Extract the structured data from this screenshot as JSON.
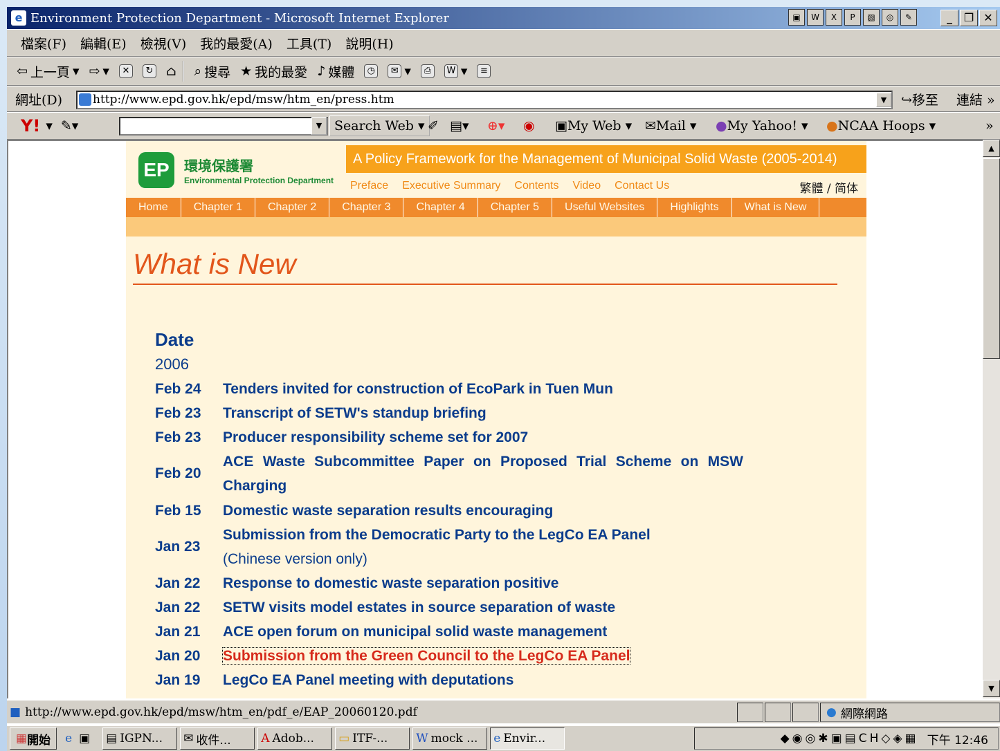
{
  "window": {
    "title": "Environment Protection Department - Microsoft Internet Explorer"
  },
  "menu": [
    "檔案(F)",
    "編輯(E)",
    "檢視(V)",
    "我的最愛(A)",
    "工具(T)",
    "說明(H)"
  ],
  "toolbar": {
    "back": "上一頁",
    "search": "搜尋",
    "favorites": "我的最愛",
    "media": "媒體"
  },
  "address": {
    "label": "網址(D)",
    "url": "http://www.epd.gov.hk/epd/msw/htm_en/press.htm",
    "go": "移至",
    "links": "連結"
  },
  "yahoo": {
    "search_label": "Search Web",
    "myweb": "My Web",
    "mail": "Mail",
    "myyahoo": "My Yahoo!",
    "ncaa": "NCAA Hoops"
  },
  "site": {
    "org_zh": "環境保護署",
    "org_en": "Environmental Protection Department",
    "banner": "A Policy Framework for the Management of Municipal Solid Waste (2005-2014)",
    "top_links": [
      "Preface",
      "Executive Summary",
      "Contents",
      "Video",
      "Contact Us"
    ],
    "lang": "繁體 / 简体",
    "nav": [
      "Home",
      "Chapter 1",
      "Chapter 2",
      "Chapter 3",
      "Chapter 4",
      "Chapter 5",
      "Useful Websites",
      "Highlights",
      "What is New"
    ]
  },
  "page": {
    "title": "What is New",
    "date_header": "Date",
    "year": "2006",
    "news": [
      {
        "date": "Feb 24",
        "text": "Tenders invited for construction of EcoPark in Tuen Mun"
      },
      {
        "date": "Feb 23",
        "text": "Transcript of SETW's standup briefing"
      },
      {
        "date": "Feb 23",
        "text": "Producer responsibility scheme set for 2007"
      },
      {
        "date": "Feb 20",
        "text": "ACE Waste Subcommittee Paper on Proposed Trial Scheme on MSW Charging"
      },
      {
        "date": "Feb 15",
        "text": "Domestic waste separation results encouraging"
      },
      {
        "date": "Jan 23",
        "text": "Submission from the Democratic Party to the LegCo EA Panel",
        "note": "(Chinese version only)"
      },
      {
        "date": "Jan 22",
        "text": "Response to domestic waste separation positive"
      },
      {
        "date": "Jan 22",
        "text": "SETW visits model estates in source separation of waste"
      },
      {
        "date": "Jan 21",
        "text": "ACE open forum on municipal solid waste management"
      },
      {
        "date": "Jan 20",
        "text": "Submission from the Green Council to the LegCo EA Panel"
      },
      {
        "date": "Jan 19",
        "text": "LegCo EA Panel meeting with deputations"
      }
    ]
  },
  "status": {
    "url": "http://www.epd.gov.hk/epd/msw/htm_en/pdf_e/EAP_20060120.pdf",
    "zone": "網際網路"
  },
  "taskbar": {
    "start": "開始",
    "tasks": [
      "IGPN...",
      "收件...",
      "Adob...",
      "ITF-...",
      "mock ...",
      "Envir..."
    ],
    "clock": "下午 12:46"
  },
  "colors": {
    "accent": "#f08a2c",
    "link": "#0b3c8c",
    "title": "#e2561b",
    "active_link": "#d62b1c",
    "page_bg": "#fff5dc"
  }
}
